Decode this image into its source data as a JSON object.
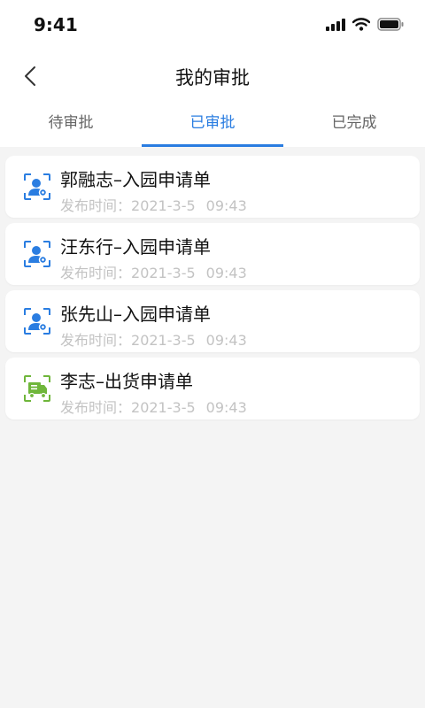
{
  "status_bar": {
    "time": "9:41"
  },
  "nav": {
    "title": "我的审批"
  },
  "tabs": [
    {
      "label": "待审批",
      "active": false
    },
    {
      "label": "已审批",
      "active": true
    },
    {
      "label": "已完成",
      "active": false
    }
  ],
  "colors": {
    "accent": "#2a7de1",
    "truck_green": "#6fb63b",
    "person_blue": "#2a7de1"
  },
  "items": [
    {
      "title": "郭融志–入园申请单",
      "meta_label": "发布时间：",
      "date": "2021-3-5",
      "time": "09:43",
      "icon": "person-scan-icon"
    },
    {
      "title": "汪东行–入园申请单",
      "meta_label": "发布时间：",
      "date": "2021-3-5",
      "time": "09:43",
      "icon": "person-scan-icon"
    },
    {
      "title": "张先山–入园申请单",
      "meta_label": "发布时间：",
      "date": "2021-3-5",
      "time": "09:43",
      "icon": "person-scan-icon"
    },
    {
      "title": "李志–出货申请单",
      "meta_label": "发布时间：",
      "date": "2021-3-5",
      "time": "09:43",
      "icon": "truck-scan-icon"
    }
  ]
}
